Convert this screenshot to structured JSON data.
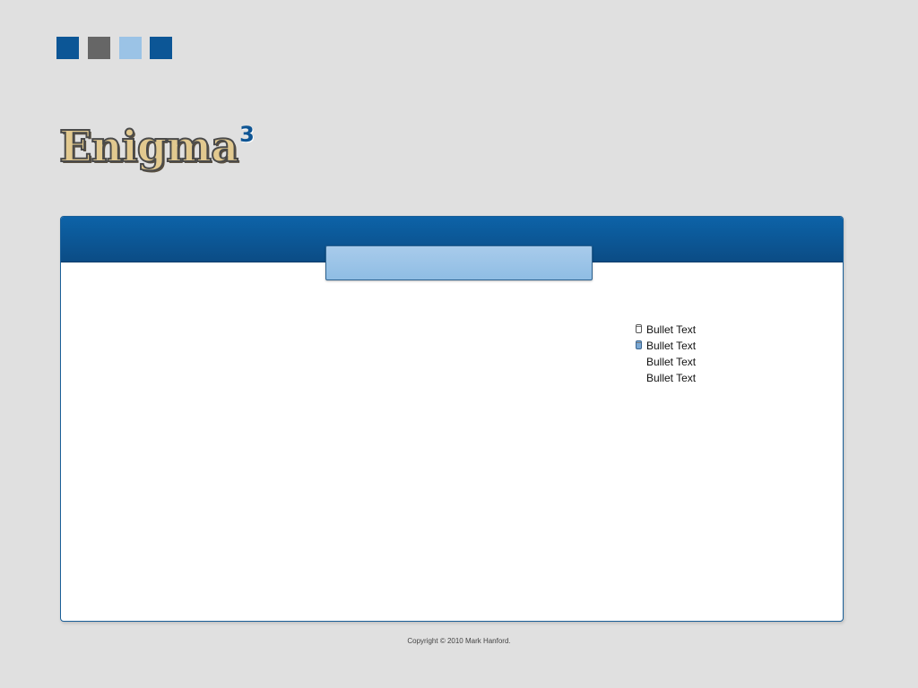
{
  "swatches": [
    {
      "color": "#0c5696"
    },
    {
      "color": "#666666"
    },
    {
      "color": "#9bc3e6"
    },
    {
      "color": "#0c5696"
    }
  ],
  "logo": {
    "text": "Enigma",
    "superscript": "3"
  },
  "panel": {
    "title": "",
    "bullets": [
      {
        "text": "Bullet Text",
        "icon": "cylinder-outline-icon"
      },
      {
        "text": "Bullet Text",
        "icon": "cylinder-filled-icon"
      },
      {
        "text": "Bullet Text",
        "icon": ""
      },
      {
        "text": "Bullet Text",
        "icon": ""
      }
    ]
  },
  "footer": {
    "copyright": "Copyright © 2010 Mark Hanford."
  }
}
